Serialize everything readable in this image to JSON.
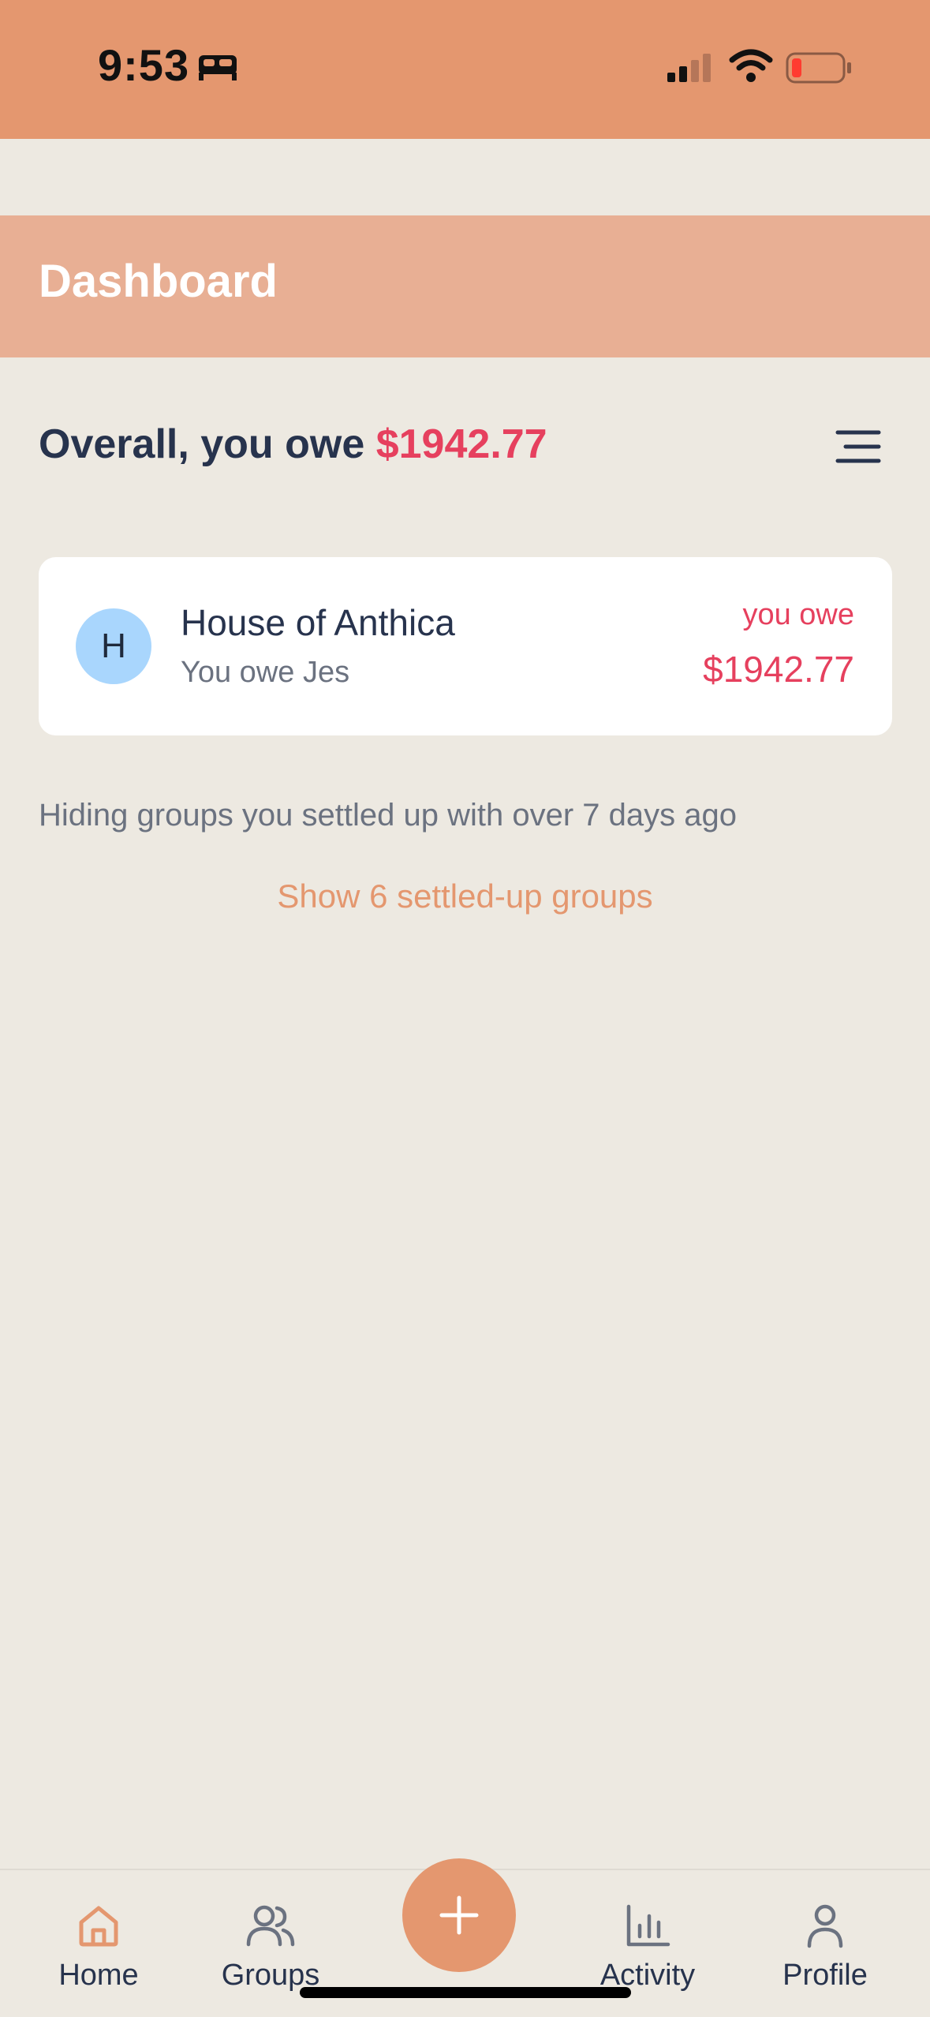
{
  "status_bar": {
    "time": "9:53",
    "icons": [
      "bed-icon",
      "signal-icon",
      "wifi-icon",
      "battery-low-icon"
    ],
    "battery_color": "#ff3b30"
  },
  "header": {
    "title": "Dashboard"
  },
  "summary": {
    "prefix": "Overall, you owe ",
    "amount": "$1942.77",
    "menu_icon": "filter-menu-icon"
  },
  "groups": [
    {
      "initial": "H",
      "name": "House of Anthica",
      "subtitle": "You owe Jes",
      "status_label": "you owe",
      "amount": "$1942.77"
    }
  ],
  "hiding_note": "Hiding groups you settled up with over 7 days ago",
  "show_settled_link": "Show 6 settled-up groups",
  "tab_bar": {
    "tabs": [
      {
        "label": "Home",
        "icon": "home-icon",
        "active": true
      },
      {
        "label": "Groups",
        "icon": "users-icon",
        "active": false
      },
      {
        "label": "Activity",
        "icon": "bar-chart-icon",
        "active": false
      },
      {
        "label": "Profile",
        "icon": "user-icon",
        "active": false
      }
    ],
    "fab_icon": "plus-icon"
  },
  "colors": {
    "accent": "#e4976f",
    "header": "#e8af94",
    "background": "#ede9e1",
    "negative": "#e6405e",
    "text": "#27334d"
  }
}
